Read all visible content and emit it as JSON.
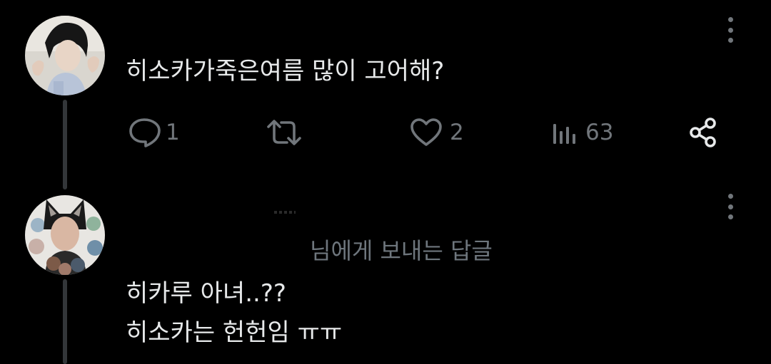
{
  "post": {
    "text": "히소카가죽은여름 많이 고어해?",
    "reply_count": "1",
    "like_count": "2",
    "view_count": "63"
  },
  "reply": {
    "replying_to": "님에게 보내는 답글",
    "line1": "히카루 아녀..??",
    "line2": "히소카는 헌헌임 ㅠㅠ"
  },
  "icons": {
    "comment": "comment-icon",
    "retweet": "retweet-icon",
    "like": "heart-icon",
    "views": "views-icon",
    "share": "share-icon",
    "more": "more-vertical-icon"
  },
  "colors": {
    "background": "#000000",
    "text": "#e7e9ea",
    "muted": "#71767b",
    "thread_line": "#333639"
  }
}
